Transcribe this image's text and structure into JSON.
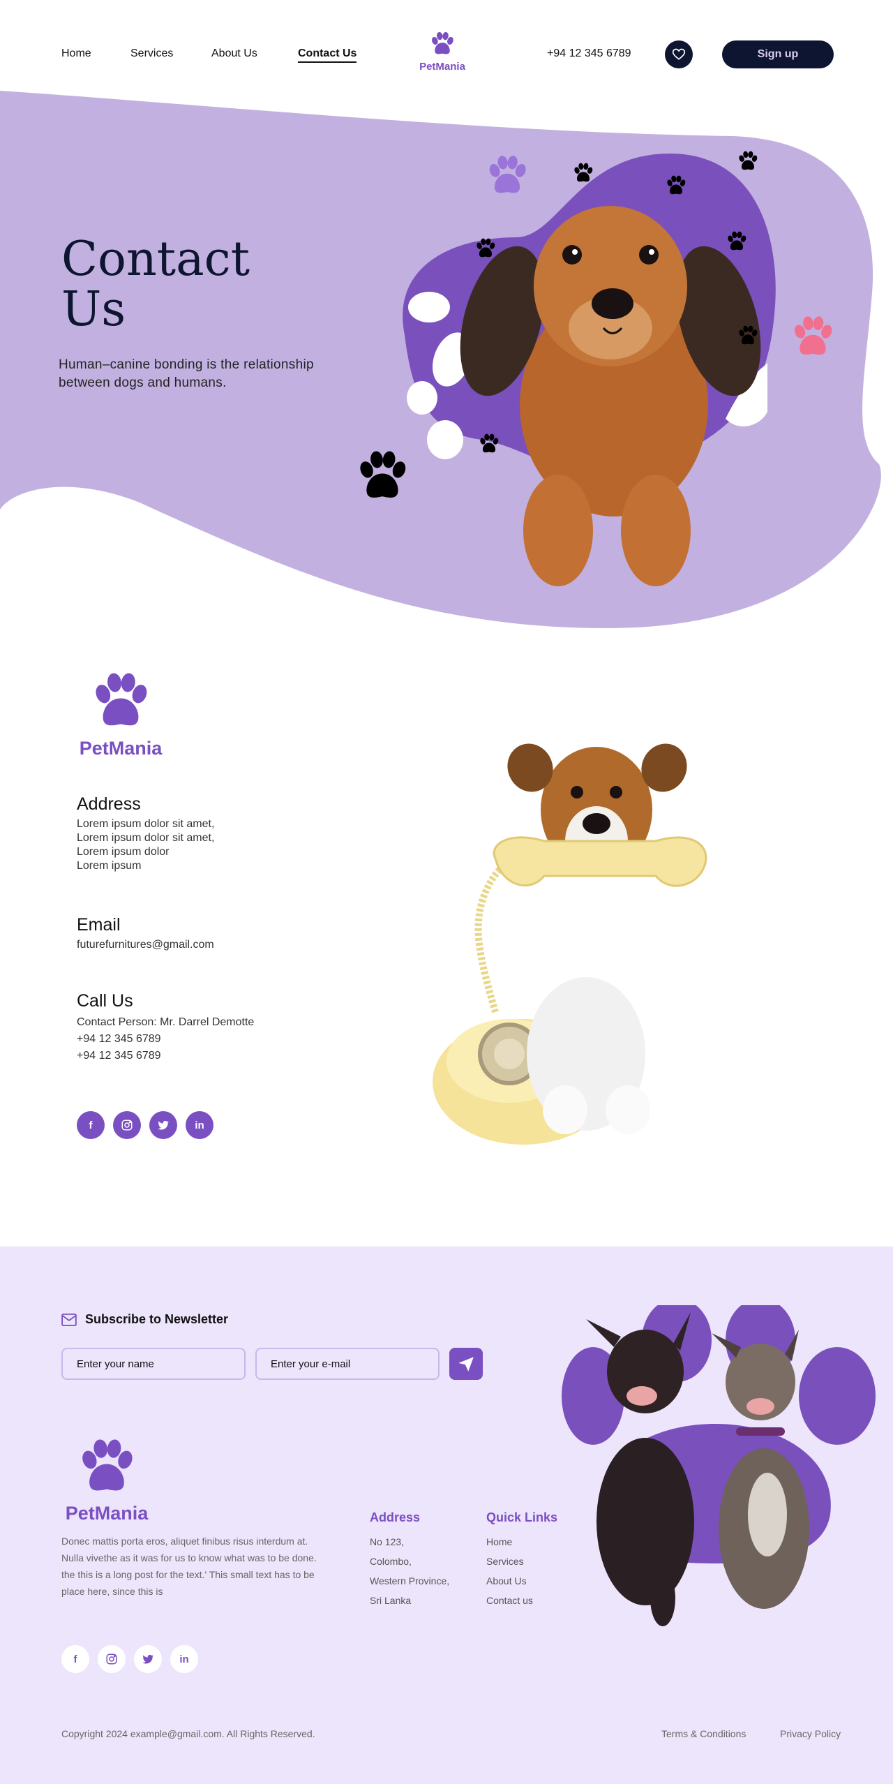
{
  "header": {
    "nav": [
      "Home",
      "Services",
      "About Us",
      "Contact Us"
    ],
    "active_nav": "Contact Us",
    "brand": "PetMania",
    "phone": "+94 12 345 6789",
    "signup_label": "Sign up"
  },
  "hero": {
    "title_line1": "Contact",
    "title_line2": "Us",
    "subtitle": "Human–canine bonding is the relationship between dogs and humans."
  },
  "contact": {
    "brand": "PetMania",
    "address_heading": "Address",
    "address_lines": [
      "Lorem ipsum dolor sit amet,",
      "Lorem ipsum dolor sit amet,",
      "Lorem ipsum dolor",
      "Lorem ipsum"
    ],
    "email_heading": "Email",
    "email": "futurefurnitures@gmail.com",
    "call_heading": "Call Us",
    "call_lines": [
      "Contact Person: Mr. Darrel Demotte",
      "+94 12 345 6789",
      "+94 12 345 6789"
    ],
    "socials": [
      "facebook-icon",
      "instagram-icon",
      "twitter-icon",
      "linkedin-icon"
    ]
  },
  "footer": {
    "newsletter_title": "Subscribe to Newsletter",
    "name_placeholder": "Enter your name",
    "email_placeholder": "Enter your e-mail",
    "brand": "PetMania",
    "about_text": "Donec mattis porta eros, aliquet finibus risus interdum at. Nulla vivethe as it was for us to know what was to be done. the this is a long  post for the text.' This small text has to be place here, since this is",
    "address_title": "Address",
    "address_lines": [
      "No 123,",
      "Colombo,",
      "Western Province,",
      "Sri Lanka"
    ],
    "links_title": "Quick Links",
    "links": [
      "Home",
      "Services",
      "About Us",
      "Contact us"
    ],
    "copyright": "Copyright 2024 example@gmail.com. All Rights Reserved.",
    "terms": "Terms & Conditions",
    "privacy": "Privacy Policy"
  },
  "colors": {
    "accent": "#7a4fc2",
    "hero_bg": "#c2b1e0",
    "footer_bg": "#ede5fc",
    "dark": "#0d1530",
    "pink": "#f2708f"
  }
}
